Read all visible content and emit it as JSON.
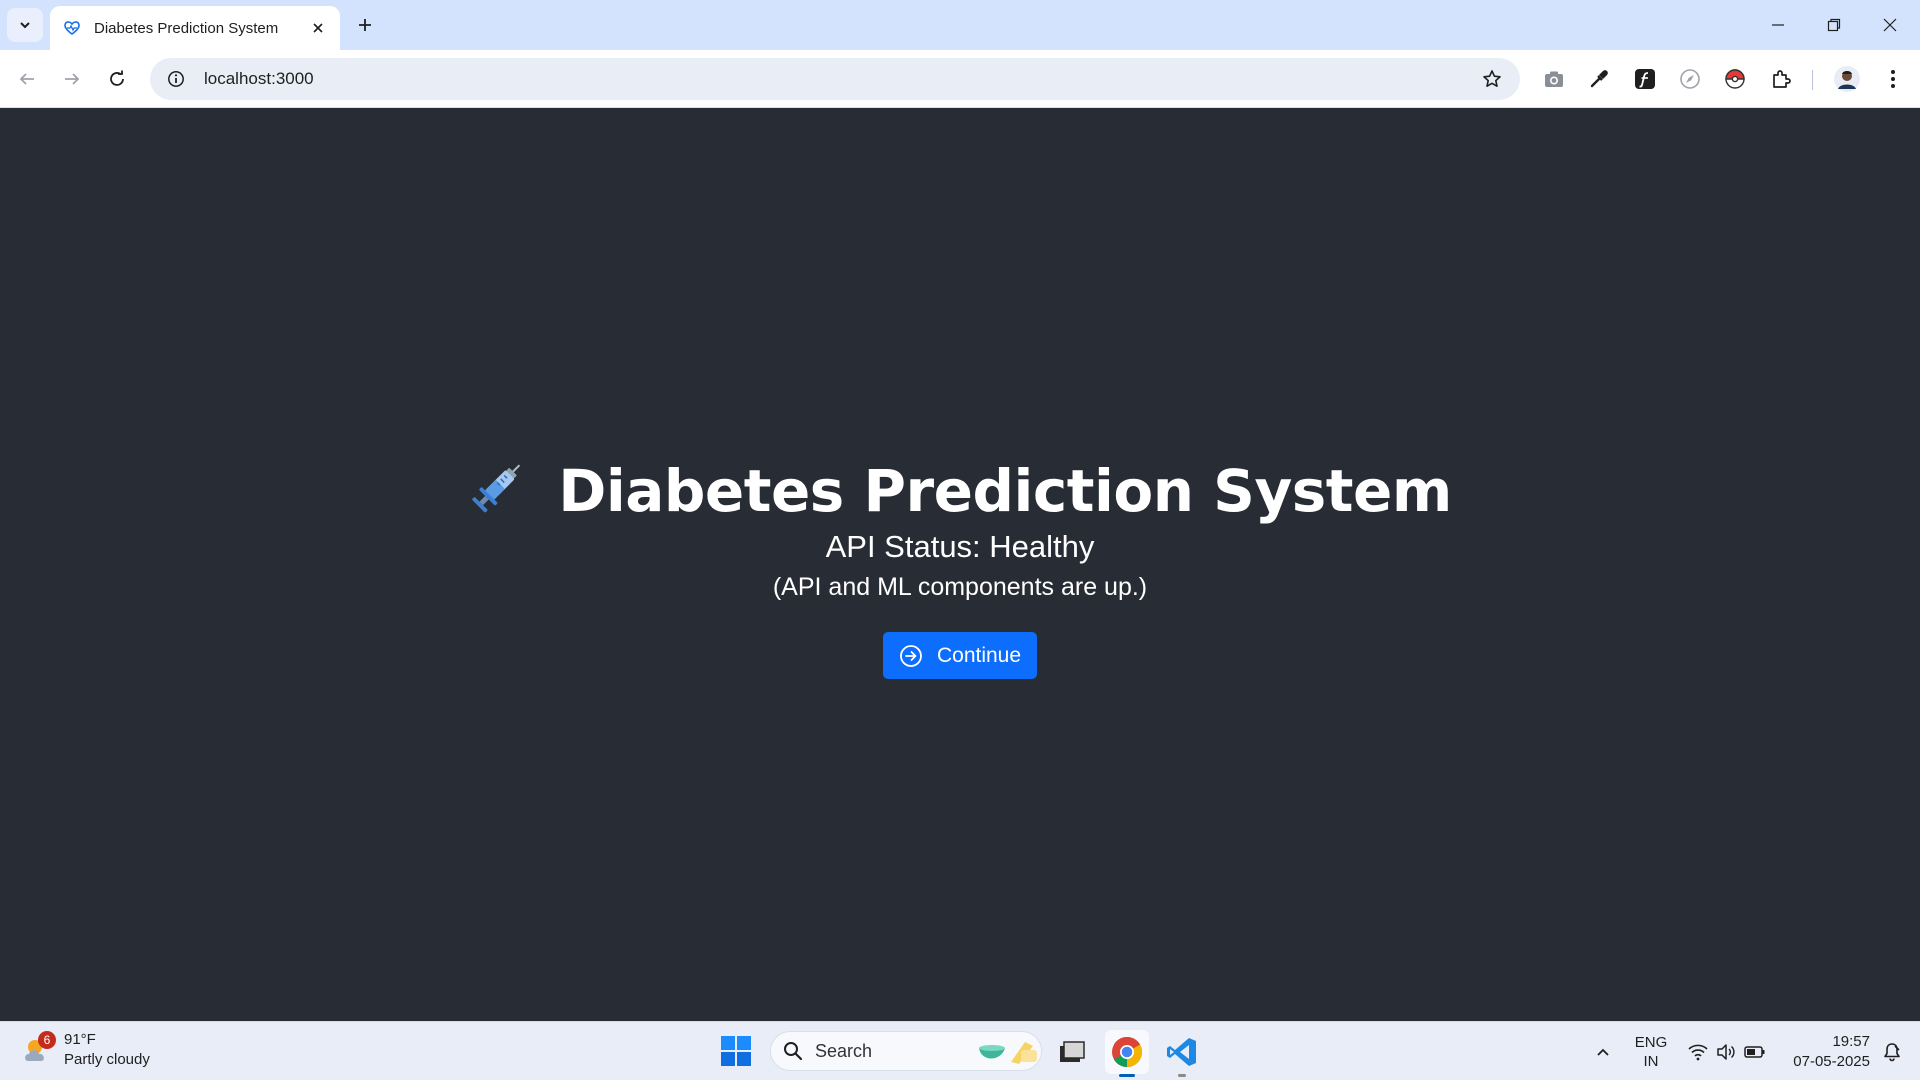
{
  "browser": {
    "tab": {
      "title": "Diabetes Prediction System"
    },
    "address_bar": {
      "url": "localhost:3000"
    }
  },
  "page": {
    "title": "Diabetes Prediction System",
    "status": "API Status: Healthy",
    "status_note": "(API and ML components are up.)",
    "continue_label": "Continue",
    "colors": {
      "background": "#282c34",
      "button": "#0d6efd",
      "text": "#ffffff"
    }
  },
  "taskbar": {
    "weather": {
      "badge": "6",
      "temp": "91°F",
      "condition": "Partly cloudy"
    },
    "search_label": "Search",
    "language": {
      "line1": "ENG",
      "line2": "IN"
    },
    "clock": {
      "time": "19:57",
      "date": "07-05-2025"
    }
  }
}
